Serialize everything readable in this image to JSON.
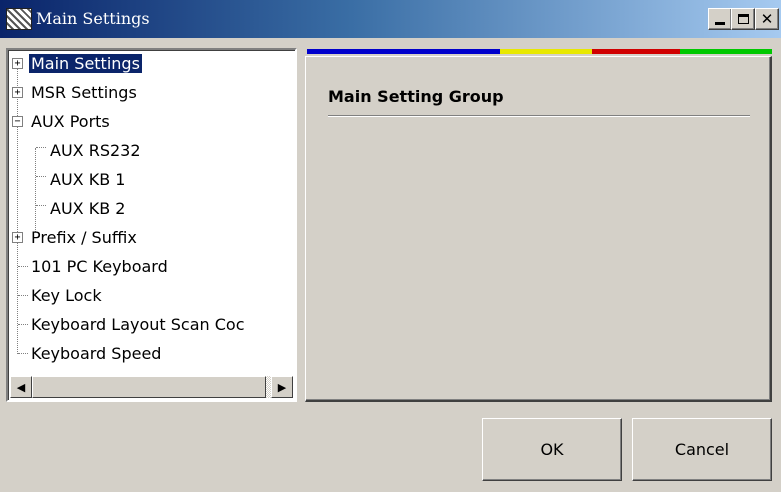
{
  "window": {
    "title": "Main Settings",
    "controls": {
      "minimize_icon": "minimize-icon",
      "maximize_icon": "maximize-icon",
      "close_icon": "close-icon"
    }
  },
  "tree": {
    "items": [
      {
        "label": "Main Settings",
        "expander": "+",
        "selected": true
      },
      {
        "label": "MSR Settings",
        "expander": "+"
      },
      {
        "label": "AUX Ports",
        "expander": "−"
      },
      {
        "label": "AUX RS232"
      },
      {
        "label": "AUX KB 1"
      },
      {
        "label": "AUX KB 2"
      },
      {
        "label": "Prefix / Suffix",
        "expander": "+"
      },
      {
        "label": "101 PC Keyboard"
      },
      {
        "label": "Key Lock"
      },
      {
        "label": "Keyboard Layout Scan Coc"
      },
      {
        "label": "Keyboard Speed"
      }
    ]
  },
  "color_bar": [
    "#0000cc",
    "#e8e800",
    "#d00000",
    "#00c800"
  ],
  "main_panel": {
    "heading": "Main Setting Group"
  },
  "buttons": {
    "ok": "OK",
    "cancel": "Cancel"
  }
}
